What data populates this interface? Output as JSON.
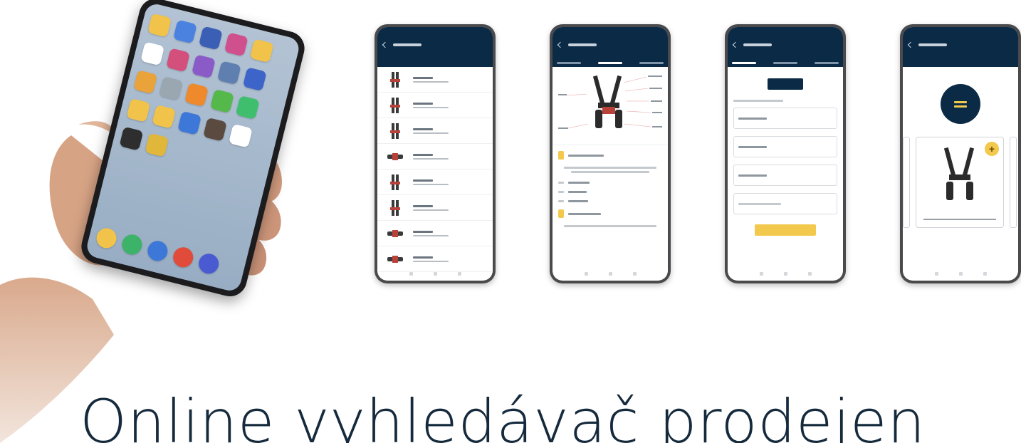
{
  "headline": "Online vyhledávač prodejen",
  "colors": {
    "navy": "#0b2a45",
    "accent_yellow": "#f2c94c",
    "headline_text": "#152a3c",
    "phone_frame": "#4a4a4d"
  },
  "hero_phone": {
    "home_rows": [
      [
        "#f1c34a",
        "#4b82e0",
        "#3b5fb5",
        "#d0508e",
        "#f1c34a"
      ],
      [
        "#ffffff",
        "#d34f7c",
        "#8a5bc7",
        "#5f7fb0",
        "#3d64c8"
      ],
      [
        "#e9a33a",
        "#9aa6b0",
        "#ef8a2c",
        "#55b84a",
        "#3fbf6d"
      ],
      [
        "#f1c34a",
        "#f1c34a",
        "#3d78d8",
        "#5a4a40",
        "#ffffff"
      ],
      [
        "#2e2e2e",
        "#e0b73a"
      ]
    ],
    "dock": [
      "#f1c34a",
      "#3db36a",
      "#3d78d8",
      "#e04b3a",
      "#4a5ad0"
    ]
  },
  "screens": [
    {
      "name": "list-screen",
      "kind": "list",
      "items": 8
    },
    {
      "name": "detail-screen",
      "kind": "detail"
    },
    {
      "name": "form-screen",
      "kind": "form",
      "fields": 4
    },
    {
      "name": "badge-screen",
      "kind": "badge"
    }
  ]
}
